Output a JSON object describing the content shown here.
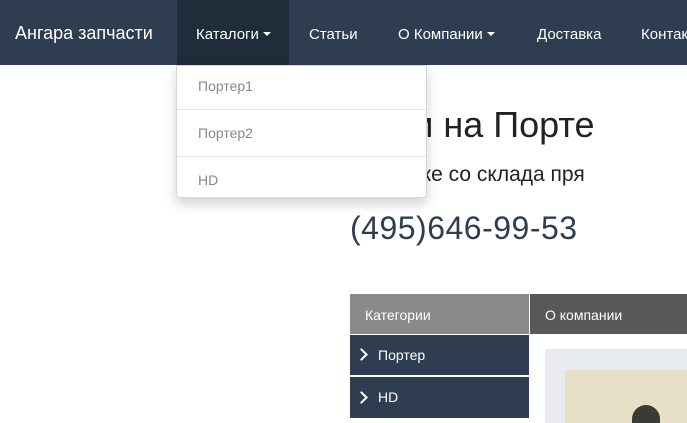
{
  "navbar": {
    "brand": "Ангара запчасти",
    "items": [
      {
        "label": "Каталоги",
        "has_caret": true
      },
      {
        "label": "Статьи",
        "has_caret": false
      },
      {
        "label": "О Компании",
        "has_caret": true
      },
      {
        "label": "Доставка",
        "has_caret": false
      },
      {
        "label": "Контак",
        "has_caret": false
      }
    ]
  },
  "dropdown": {
    "items": [
      "Портер1",
      "Портер2",
      "HD"
    ]
  },
  "hero": {
    "title": "части на Порте",
    "subtitle": "к отправке со склада пря",
    "phone": "(495)646-99-53"
  },
  "sidebar": {
    "header": "Категории",
    "items": [
      "Портер",
      "HD"
    ]
  },
  "about": {
    "header": "О компании"
  },
  "colors": {
    "navbar_bg": "#2e3e50",
    "navbar_active": "#1f2c39",
    "category_header": "#8a8a8a",
    "about_header": "#585858",
    "category_item": "#2e3e50"
  }
}
